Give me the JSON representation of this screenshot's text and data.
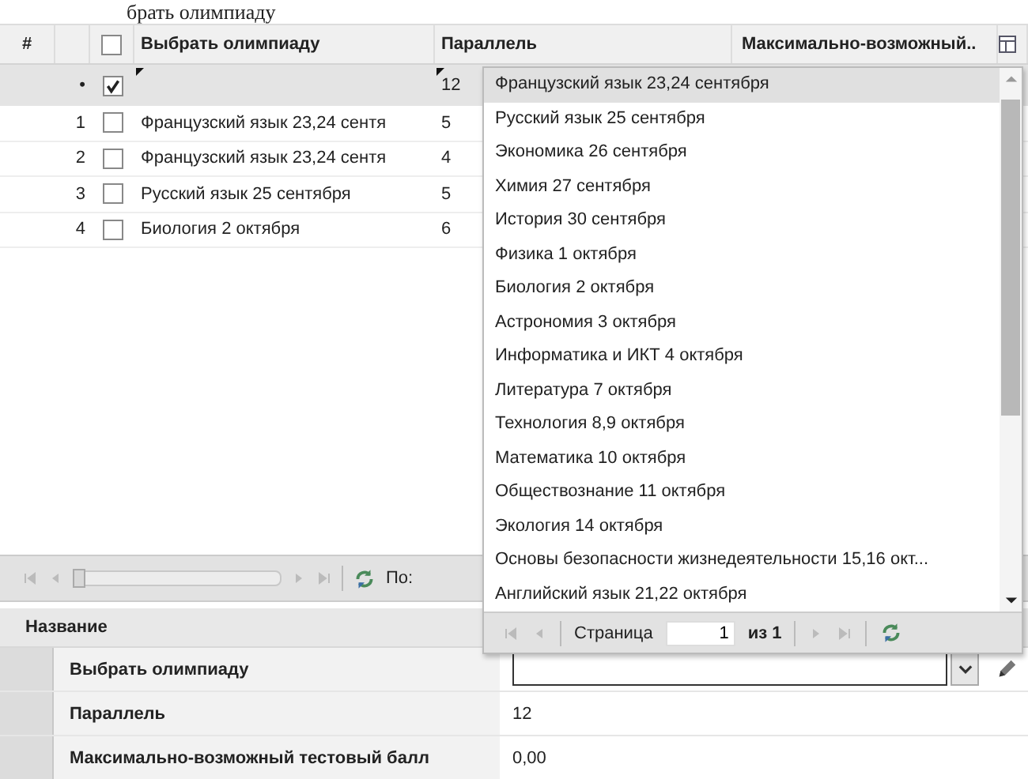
{
  "heading": "брать олимпиаду",
  "grid": {
    "columns": [
      {
        "label": "#"
      },
      {
        "label": "Выбрать олимпиаду"
      },
      {
        "label": "Параллель"
      },
      {
        "label": "Максимально-возможный.."
      }
    ],
    "header_checked": false,
    "edit_row": {
      "marker": "•",
      "checked": true,
      "parallel": "12"
    },
    "rows": [
      {
        "number": "1",
        "checked": false,
        "name": "Французский язык 23,24 сентя",
        "parallel": "5"
      },
      {
        "number": "2",
        "checked": false,
        "name": "Французский язык 23,24 сентя",
        "parallel": "4"
      },
      {
        "number": "3",
        "checked": false,
        "name": "Русский язык 25 сентября",
        "parallel": "5"
      },
      {
        "number": "4",
        "checked": false,
        "name": "Биология 2 октября",
        "parallel": "6"
      }
    ],
    "pager": {
      "level": 0,
      "label": "По:"
    }
  },
  "dropdown": {
    "items": [
      {
        "label": "Французский язык 23,24 сентября",
        "selected": true
      },
      {
        "label": "Русский язык 25 сентября",
        "selected": false
      },
      {
        "label": "Экономика 26 сентября",
        "selected": false
      },
      {
        "label": "Химия 27 сентября",
        "selected": false
      },
      {
        "label": "История 30 сентября",
        "selected": false
      },
      {
        "label": "Физика 1 октября",
        "selected": false
      },
      {
        "label": "Биология 2 октября",
        "selected": false
      },
      {
        "label": "Астрономия 3 октября",
        "selected": false
      },
      {
        "label": "Информатика и ИКТ 4 октября",
        "selected": false
      },
      {
        "label": "Литература 7 октября",
        "selected": false
      },
      {
        "label": "Технология 8,9 октября",
        "selected": false
      },
      {
        "label": "Математика 10 октября",
        "selected": false
      },
      {
        "label": "Обществознание 11 октября",
        "selected": false
      },
      {
        "label": "Экология 14 октября",
        "selected": false
      },
      {
        "label": "Основы безопасности жизнедеятельности 15,16 окт...",
        "selected": false
      },
      {
        "label": "Английский язык 21,22 октября",
        "selected": false
      }
    ],
    "pager": {
      "page_label": "Страница",
      "page": "1",
      "of": "из 1"
    }
  },
  "properties": {
    "header": "Название",
    "rows": [
      {
        "kind": "combo",
        "name": "Выбрать олимпиаду"
      },
      {
        "kind": "text",
        "name": "Параллель",
        "value": "12"
      },
      {
        "kind": "text",
        "name": "Максимально-возможный тестовый балл",
        "value": "0,00"
      }
    ]
  }
}
